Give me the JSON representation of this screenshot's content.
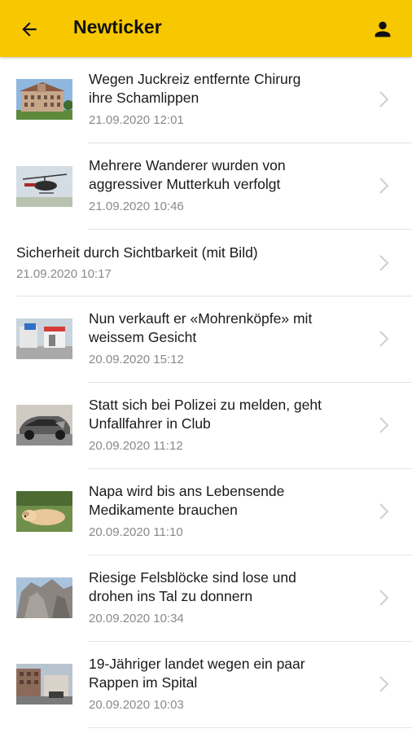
{
  "appbar": {
    "title": "Newticker",
    "back_icon": "arrow-left-icon",
    "profile_icon": "person-icon",
    "color": "#f7c800"
  },
  "articles": [
    {
      "title_line1": "Wegen Juckreiz entfernte Chirurg",
      "title_line2": "ihre Schamlippen",
      "date": "21.09.2020 12:01",
      "thumbnail": "building"
    },
    {
      "title_line1": "Mehrere Wanderer wurden von",
      "title_line2": "aggressiver Mutterkuh verfolgt",
      "date": "21.09.2020 10:46",
      "thumbnail": "helicopter"
    },
    {
      "title_line1": "Sicherheit durch Sichtbarkeit (mit Bild)",
      "title_line2": "",
      "date": "21.09.2020 10:17",
      "thumbnail": ""
    },
    {
      "title_line1": "Nun verkauft er «Mohrenköpfe» mit",
      "title_line2": "weissem Gesicht",
      "date": "20.09.2020 15:12",
      "thumbnail": "shop"
    },
    {
      "title_line1": "Statt sich bei Polizei zu melden, geht",
      "title_line2": "Unfallfahrer in Club",
      "date": "20.09.2020 11:12",
      "thumbnail": "car"
    },
    {
      "title_line1": "Napa wird bis ans Lebensende",
      "title_line2": "Medikamente brauchen",
      "date": "20.09.2020 11:10",
      "thumbnail": "dog"
    },
    {
      "title_line1": "Riesige Felsblöcke sind lose und",
      "title_line2": "drohen ins Tal zu donnern",
      "date": "20.09.2020 10:34",
      "thumbnail": "rock"
    },
    {
      "title_line1": "19-Jähriger landet wegen ein paar",
      "title_line2": "Rappen im Spital",
      "date": "20.09.2020 10:03",
      "thumbnail": "street"
    }
  ]
}
